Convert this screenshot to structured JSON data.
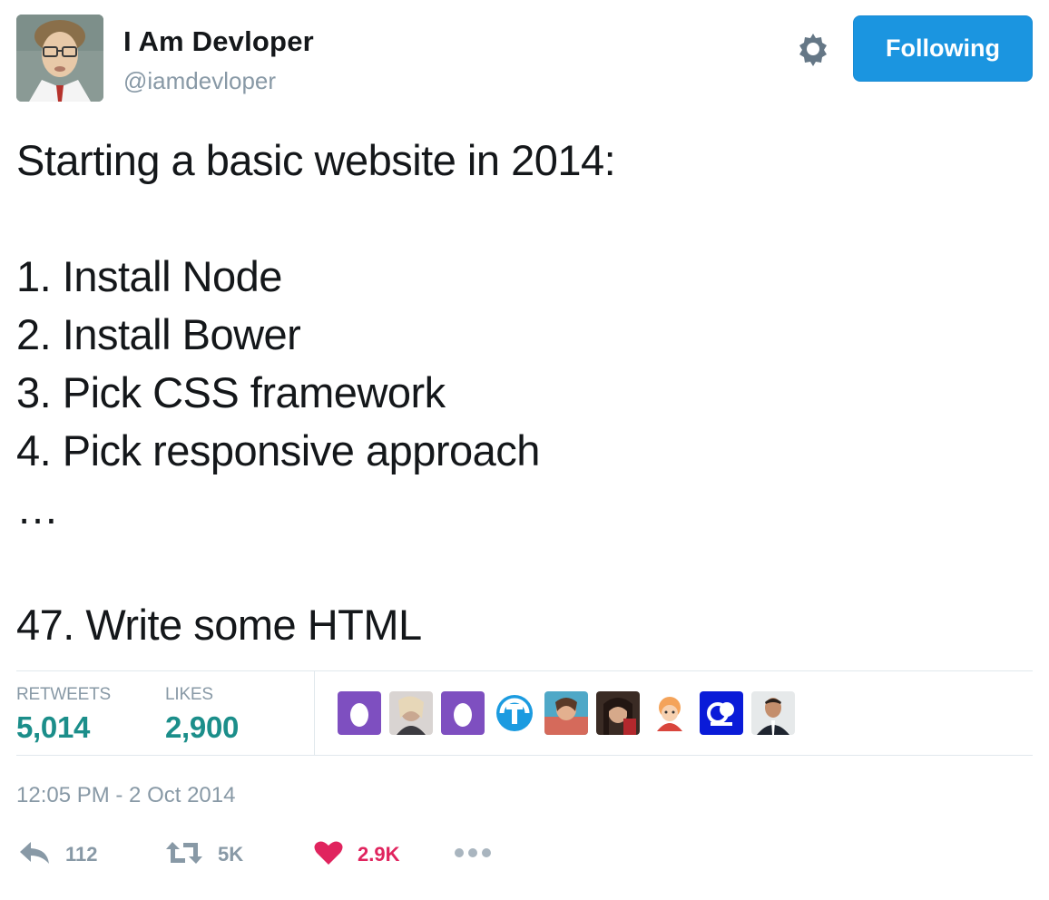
{
  "header": {
    "display_name": "I Am Devloper",
    "handle": "@iamdevloper",
    "follow_label": "Following"
  },
  "tweet": {
    "lines": [
      "Starting a basic website in 2014:",
      "",
      "1. Install Node",
      "2. Install Bower",
      "3. Pick CSS framework",
      "4. Pick responsive approach",
      "…",
      "",
      "47. Write some HTML"
    ]
  },
  "stats": {
    "retweets_label": "RETWEETS",
    "retweets_value": "5,014",
    "likes_label": "LIKES",
    "likes_value": "2,900",
    "likers": [
      "egg-avatar",
      "user-avatar",
      "egg-avatar",
      "logo-avatar",
      "user-avatar",
      "user-avatar",
      "cartoon-avatar",
      "logo-avatar",
      "user-avatar"
    ]
  },
  "timestamp": "12:05 PM - 2 Oct 2014",
  "actions": {
    "reply_count": "112",
    "retweet_count": "5K",
    "like_count": "2.9K"
  },
  "colors": {
    "follow_button": "#1b95e0",
    "stat_value": "#1b8e8a",
    "like": "#e0245e",
    "muted": "#8899a6",
    "egg_purple": "#7e4fc0"
  }
}
